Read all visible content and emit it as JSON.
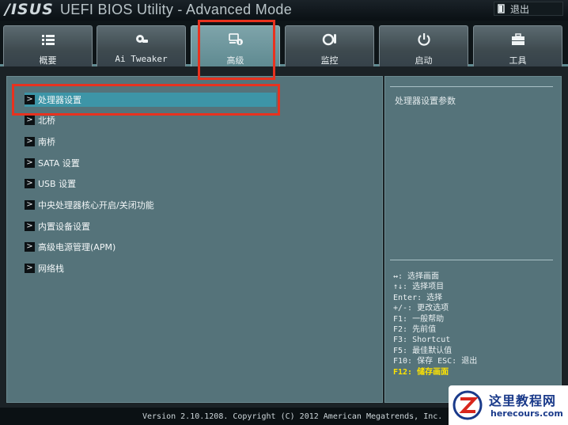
{
  "header": {
    "logo": "/ISUS",
    "title": "UEFI BIOS Utility - Advanced Mode",
    "exit_label": "退出"
  },
  "tabs": [
    {
      "label": "概要",
      "icon": "list-icon"
    },
    {
      "label": "Ai Tweaker",
      "icon": "ai-tweaker-icon"
    },
    {
      "label": "高级",
      "icon": "advanced-icon",
      "active": true
    },
    {
      "label": "监控",
      "icon": "monitor-icon"
    },
    {
      "label": "启动",
      "icon": "power-icon"
    },
    {
      "label": "工具",
      "icon": "toolbox-icon"
    }
  ],
  "menu": {
    "items": [
      {
        "label": "处理器设置",
        "selected": true
      },
      {
        "label": "北桥"
      },
      {
        "label": "南桥"
      },
      {
        "label": "SATA 设置"
      },
      {
        "label": "USB 设置"
      },
      {
        "label": "中央处理器核心开启/关闭功能"
      },
      {
        "label": "内置设备设置"
      },
      {
        "label": "高级电源管理(APM)"
      },
      {
        "label": "网络栈"
      }
    ]
  },
  "help": {
    "title": "处理器设置参数",
    "keys": [
      "↔: 选择画面",
      "↑↓: 选择项目",
      "Enter: 选择",
      "+/-: 更改选项",
      "F1: 一般帮助",
      "F2: 先前值",
      "F3: Shortcut",
      "F5: 最佳默认值",
      "F10: 保存  ESC: 退出",
      "F12: 储存画面"
    ]
  },
  "footer": {
    "version": "Version 2.10.1208. Copyright (C) 2012 American Megatrends, Inc."
  },
  "watermark": {
    "title": "这里教程网",
    "url": "herecours.com"
  },
  "colors": {
    "panel": "#55737a",
    "selected": "#3d95a7",
    "accent": "#5f8a91",
    "highlight_key": "#ffe400",
    "annotation_red": "#e8321f"
  }
}
